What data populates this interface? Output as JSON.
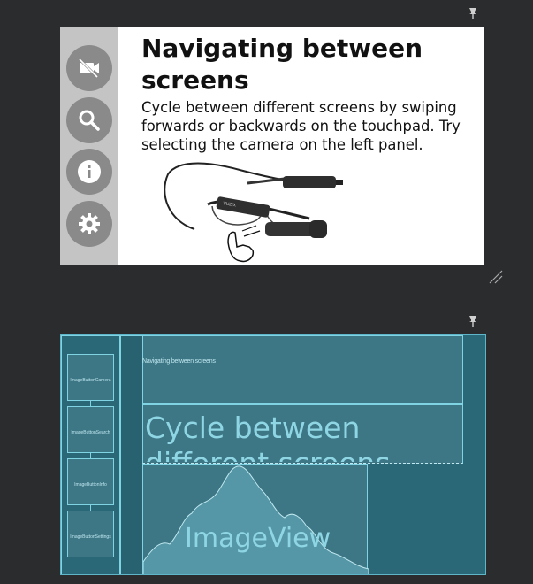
{
  "design": {
    "title": "Navigating between screens",
    "body": "Cycle between different screens by swiping forwards or backwards on the touchpad. Try selecting the camera on the left panel.",
    "sidebar_icons": [
      "camera-off-icon",
      "search-icon",
      "info-icon",
      "settings-icon"
    ],
    "image_text": "VUZIX"
  },
  "blueprint": {
    "title_text": "Navigating between screens",
    "body_text_line1": "Cycle between",
    "body_text_line2": "different screens",
    "buttons": [
      "ImageButtonCamera",
      "ImageButtonSearch",
      "ImageButtonInfo",
      "ImageButtonSettings"
    ],
    "image_label": "ImageView"
  },
  "colors": {
    "canvas": "#2b2c2e",
    "sidebar": "#c4c4c4",
    "icon_circle": "#8a8a8a",
    "blueprint_bg": "#2a6878",
    "blueprint_line": "#7fd3e3"
  }
}
